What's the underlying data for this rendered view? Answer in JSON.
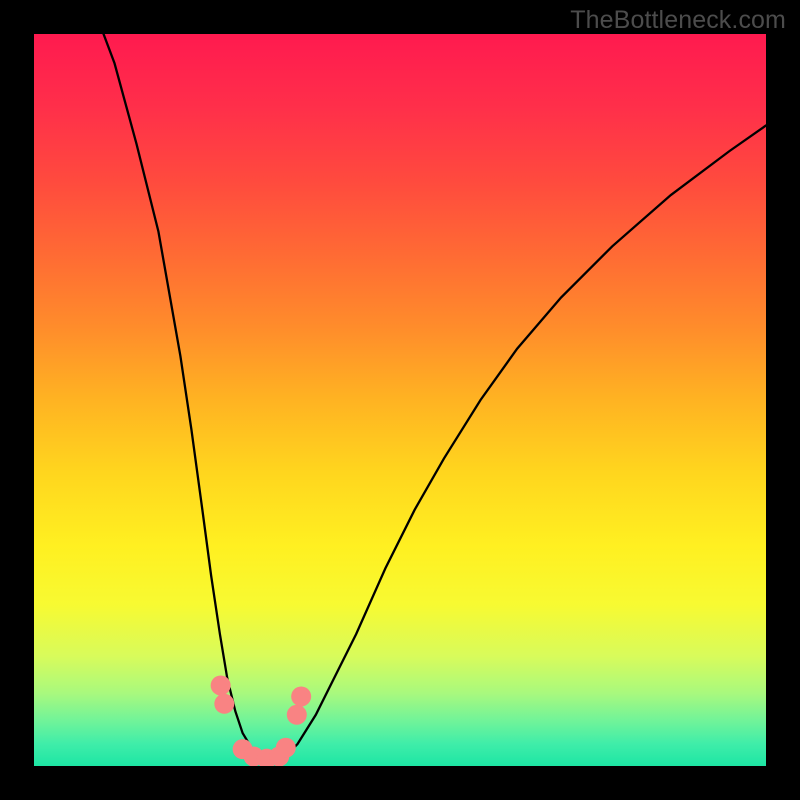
{
  "watermark": "TheBottleneck.com",
  "gradient": {
    "stops": [
      {
        "offset": 0,
        "color": "#ff1a4f"
      },
      {
        "offset": 0.1,
        "color": "#ff2f4a"
      },
      {
        "offset": 0.2,
        "color": "#ff4a3e"
      },
      {
        "offset": 0.3,
        "color": "#ff6a34"
      },
      {
        "offset": 0.4,
        "color": "#ff8c2b"
      },
      {
        "offset": 0.5,
        "color": "#ffb322"
      },
      {
        "offset": 0.6,
        "color": "#ffd61e"
      },
      {
        "offset": 0.7,
        "color": "#fff021"
      },
      {
        "offset": 0.78,
        "color": "#f7fa32"
      },
      {
        "offset": 0.85,
        "color": "#d8fb5b"
      },
      {
        "offset": 0.9,
        "color": "#a9f97d"
      },
      {
        "offset": 0.94,
        "color": "#6ef39a"
      },
      {
        "offset": 0.97,
        "color": "#3feda9"
      },
      {
        "offset": 1.0,
        "color": "#1de6a4"
      }
    ]
  },
  "chart_data": {
    "type": "line",
    "title": "",
    "xlabel": "",
    "ylabel": "",
    "xlim": [
      0,
      1
    ],
    "ylim": [
      0,
      1
    ],
    "series": [
      {
        "name": "curve",
        "x": [
          0.08,
          0.11,
          0.14,
          0.17,
          0.2,
          0.215,
          0.23,
          0.242,
          0.254,
          0.264,
          0.275,
          0.285,
          0.297,
          0.31,
          0.325,
          0.34,
          0.36,
          0.385,
          0.41,
          0.44,
          0.48,
          0.52,
          0.56,
          0.61,
          0.66,
          0.72,
          0.79,
          0.87,
          0.95,
          1.0
        ],
        "y": [
          1.04,
          0.96,
          0.85,
          0.73,
          0.56,
          0.46,
          0.35,
          0.26,
          0.18,
          0.12,
          0.075,
          0.045,
          0.025,
          0.012,
          0.005,
          0.01,
          0.03,
          0.07,
          0.12,
          0.18,
          0.27,
          0.35,
          0.42,
          0.5,
          0.57,
          0.64,
          0.71,
          0.78,
          0.84,
          0.875
        ]
      }
    ],
    "markers": {
      "name": "dots",
      "color": "#f98383",
      "radius_px": 10,
      "x": [
        0.255,
        0.26,
        0.285,
        0.3,
        0.318,
        0.335,
        0.344,
        0.359,
        0.365
      ],
      "y": [
        0.11,
        0.085,
        0.023,
        0.013,
        0.01,
        0.013,
        0.025,
        0.07,
        0.095
      ]
    }
  }
}
